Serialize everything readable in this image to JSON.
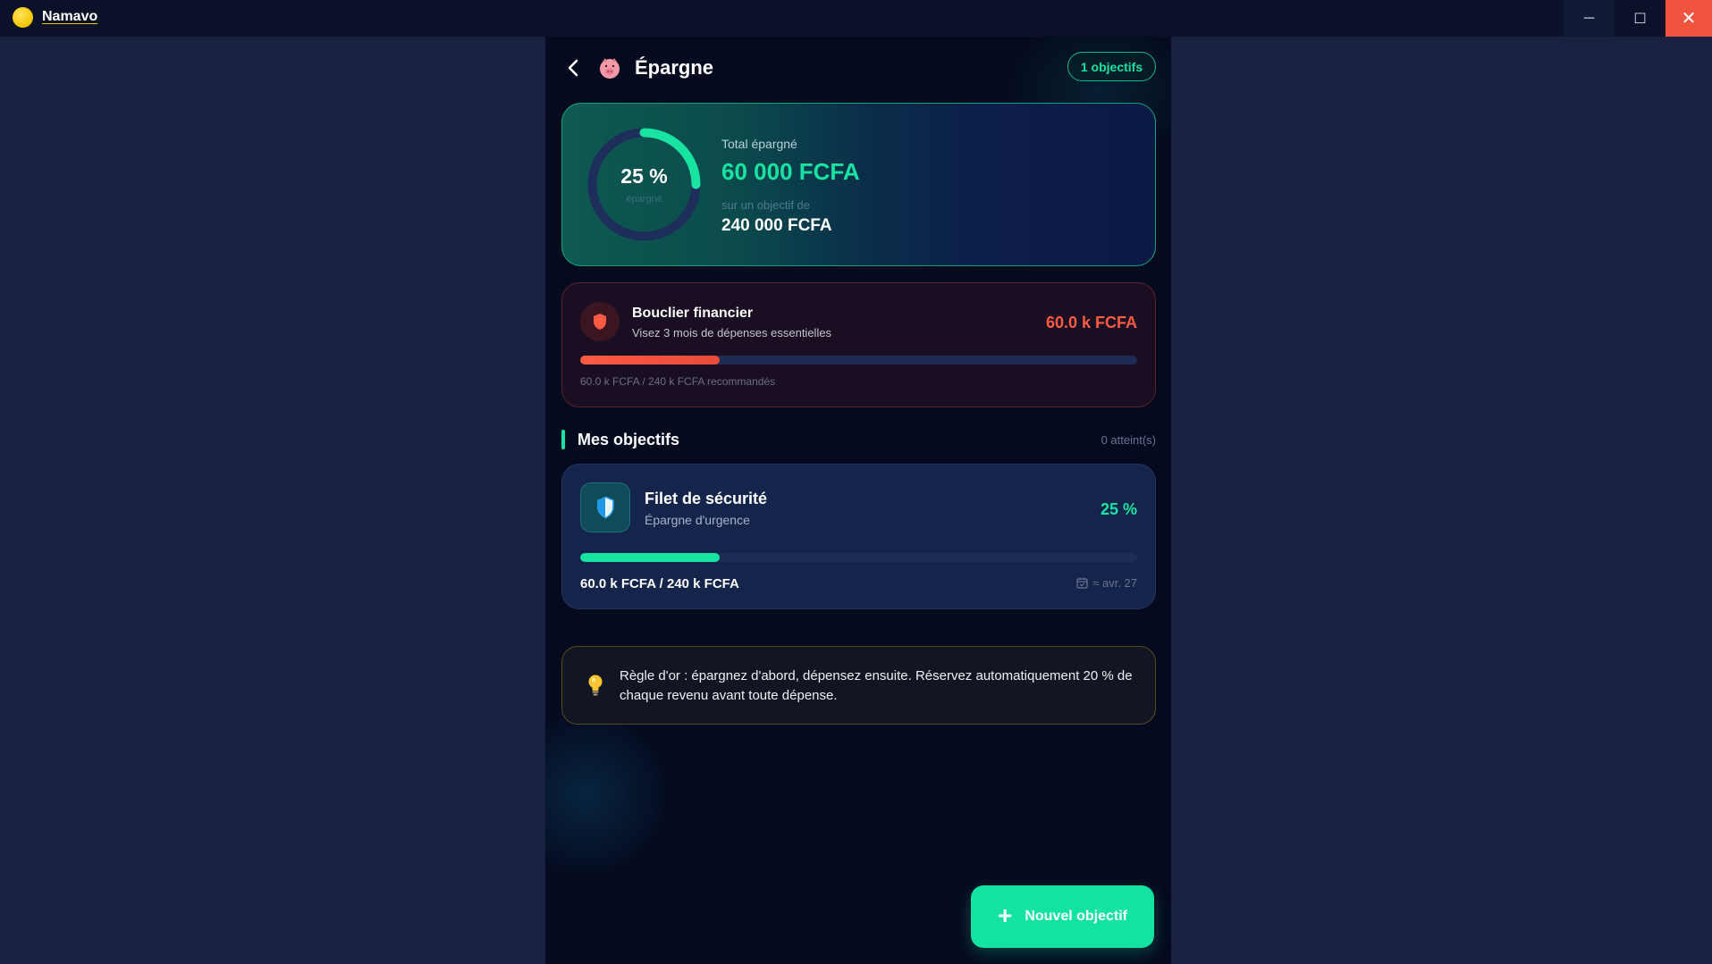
{
  "window": {
    "title": "Namavo",
    "minimize_label": "─",
    "maximize_label": "☐",
    "close_label": "✕"
  },
  "header": {
    "title": "Épargne",
    "badge": "1 objectifs"
  },
  "total_card": {
    "percent_label": "25 %",
    "percent_value": 25,
    "percent_sub": "épargné",
    "total_label": "Total épargné",
    "total_amount": "60 000 FCFA",
    "target_label": "sur un objectif de",
    "target_amount": "240 000 FCFA"
  },
  "shield_card": {
    "title": "Bouclier financier",
    "subtitle": "Visez 3 mois de dépenses essentielles",
    "amount": "60.0 k FCFA",
    "progress": 25,
    "footer": "60.0 k FCFA / 240 k FCFA recommandés"
  },
  "goals_section": {
    "title": "Mes objectifs",
    "count": "0 atteint(s)"
  },
  "goals": [
    {
      "title": "Filet de sécurité",
      "subtitle": "Épargne d'urgence",
      "percent": "25 %",
      "progress": 25,
      "amount": "60.0 k FCFA / 240 k FCFA",
      "date": "≈ avr. 27"
    }
  ],
  "tip": {
    "text": "Règle d'or : épargnez d'abord, dépensez ensuite. Réservez automatiquement 20 % de chaque revenu avant toute dépense."
  },
  "fab": {
    "label": "Nouvel objectif",
    "plus": "+"
  },
  "colors": {
    "accent": "#19e3a1",
    "danger": "#ff5a43",
    "background": "#050a1f",
    "outer_background": "#18213f"
  },
  "icons": {
    "app": "coin-icon",
    "back": "chevron-left-icon",
    "header": "piggy-bank-icon",
    "shield": "shield-icon",
    "goal": "shield-half-icon",
    "date": "calendar-icon",
    "tip": "lightbulb-icon"
  }
}
